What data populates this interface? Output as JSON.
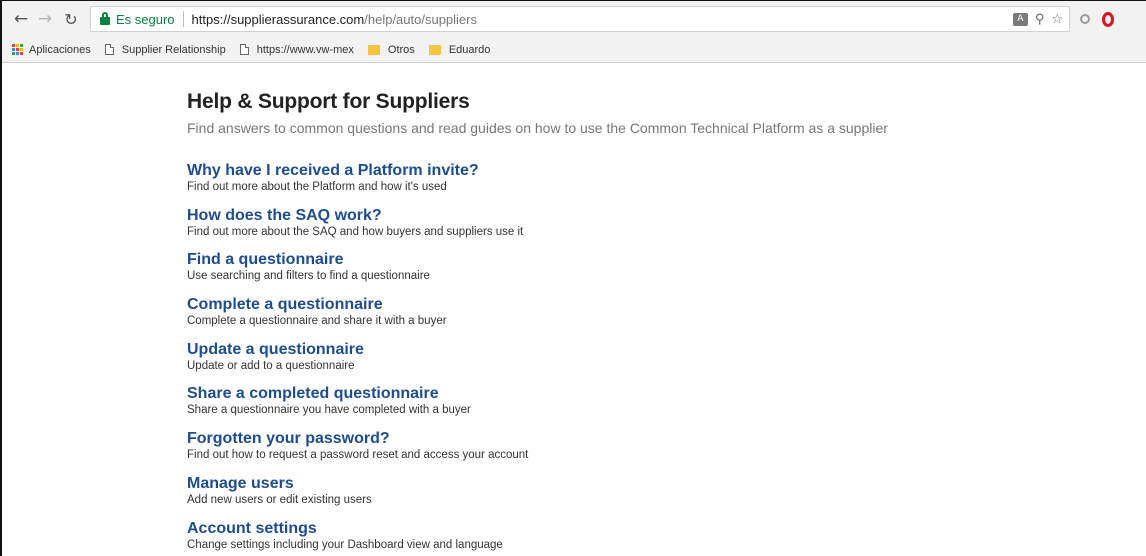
{
  "browser": {
    "secure_label": "Es seguro",
    "url_base": "https://supplierassurance.com",
    "url_path": "/help/auto/suppliers",
    "bookmarks": [
      {
        "label": "Aplicaciones",
        "icon": "apps-icon"
      },
      {
        "label": "Supplier Relationship",
        "icon": "page-icon"
      },
      {
        "label": "https://www.vw-mex",
        "icon": "page-icon"
      },
      {
        "label": "Otros",
        "icon": "folder-icon"
      },
      {
        "label": "Eduardo",
        "icon": "folder-icon"
      }
    ]
  },
  "page": {
    "title": "Help & Support for Suppliers",
    "subtitle": "Find answers to common questions and read guides on how to use the Common Technical Platform as a supplier"
  },
  "topics": [
    {
      "title": "Why have I received a Platform invite?",
      "description": "Find out more about the Platform and how it's used"
    },
    {
      "title": "How does the SAQ work?",
      "description": "Find out more about the SAQ and how buyers and suppliers use it"
    },
    {
      "title": "Find a questionnaire",
      "description": "Use searching and filters to find a questionnaire"
    },
    {
      "title": "Complete a questionnaire",
      "description": "Complete a questionnaire and share it with a buyer"
    },
    {
      "title": "Update a questionnaire",
      "description": "Update or add to a questionnaire"
    },
    {
      "title": "Share a completed questionnaire",
      "description": "Share a questionnaire you have completed with a buyer"
    },
    {
      "title": "Forgotten your password?",
      "description": "Find out how to request a password reset and access your account"
    },
    {
      "title": "Manage users",
      "description": "Add new users or edit existing users"
    },
    {
      "title": "Account settings",
      "description": "Change settings including your Dashboard view and language"
    }
  ],
  "colors": {
    "link": "#1d4d8f",
    "secure": "#0b8043",
    "folder": "#f4c542"
  }
}
